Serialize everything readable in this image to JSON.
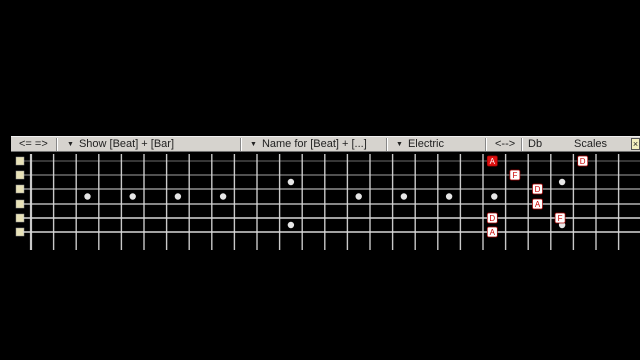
{
  "toolbar": {
    "nav_label": "<= =>",
    "display_option": "Show [Beat] + [Bar]",
    "name_option": "Name for [Beat] + [...]",
    "guitar_type": "Electric",
    "scroll_label": "<-->",
    "key": "Db",
    "mode": "Scales"
  },
  "fretboard": {
    "string_count": 6,
    "frets_visible": 27,
    "inlay_frets": [
      3,
      5,
      7,
      9,
      15,
      17,
      19,
      21
    ],
    "double_inlay_frets": [
      12,
      24
    ],
    "notes": [
      {
        "label": "A",
        "string": 1,
        "fret": 21,
        "style": "root"
      },
      {
        "label": "D",
        "string": 1,
        "fret": 25,
        "style": "normal"
      },
      {
        "label": "F",
        "string": 2,
        "fret": 22,
        "style": "normal"
      },
      {
        "label": "D",
        "string": 3,
        "fret": 23,
        "style": "normal"
      },
      {
        "label": "A",
        "string": 4,
        "fret": 23,
        "style": "normal"
      },
      {
        "label": "F",
        "string": 5,
        "fret": 24,
        "style": "normal"
      },
      {
        "label": "D",
        "string": 5,
        "fret": 21,
        "style": "normal"
      },
      {
        "label": "A",
        "string": 6,
        "fret": 21,
        "style": "normal"
      }
    ]
  },
  "colors": {
    "toolbar_bg": "#d6d3ce",
    "fret": "#c9c9c9",
    "string": "#d8d8d8",
    "nut": "#e8e2b8",
    "inlay": "#e6e6e6",
    "note_fill": "#ffffff",
    "note_text": "#cc0000",
    "root_fill": "#dd1111",
    "root_text": "#ffffff"
  },
  "icons": {
    "close": "close-icon",
    "dropdown": "triangle-down-icon"
  }
}
